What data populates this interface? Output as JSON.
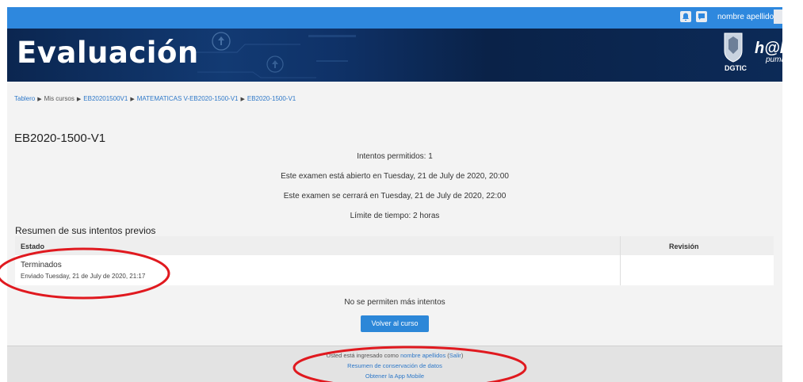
{
  "topbar": {
    "user_name": "nombre apellidos",
    "icons": [
      "notifications-icon",
      "messages-icon"
    ]
  },
  "banner": {
    "title": "Evaluación",
    "logo_text": "DGTIC",
    "brand_main": "h@bitat",
    "brand_sub": "puma"
  },
  "breadcrumb": {
    "items": [
      "Tablero",
      "Mis cursos",
      "EB20201500V1",
      "MATEMATICAS V-EB2020-1500-V1",
      "EB2020-1500-V1"
    ]
  },
  "quiz": {
    "title": "EB2020-1500-V1",
    "info": [
      "Intentos permitidos: 1",
      "Este examen está abierto en Tuesday, 21 de July de 2020, 20:00",
      "Este examen se cerrará en Tuesday, 21 de July de 2020, 22:00",
      "Límite de tiempo: 2 horas"
    ]
  },
  "summary": {
    "title": "Resumen de sus intentos previos",
    "col_state": "Estado",
    "col_review": "Revisión",
    "row_state": "Terminados",
    "row_submitted": "Enviado Tuesday, 21 de July de 2020, 21:17",
    "row_review": ""
  },
  "no_more_attempts": "No se permiten más intentos",
  "back_button": "Volver al curso",
  "footer": {
    "logged_prefix": "Usted está ingresado como",
    "user_link": "nombre apellidos",
    "logout_link": "Salir",
    "data_retention": "Resumen de conservación de datos",
    "mobile_app": "Obtener la App Mobile"
  },
  "colors": {
    "navbar": "#2e88de",
    "annotation": "#e0191f",
    "button": "#2c87d8"
  }
}
